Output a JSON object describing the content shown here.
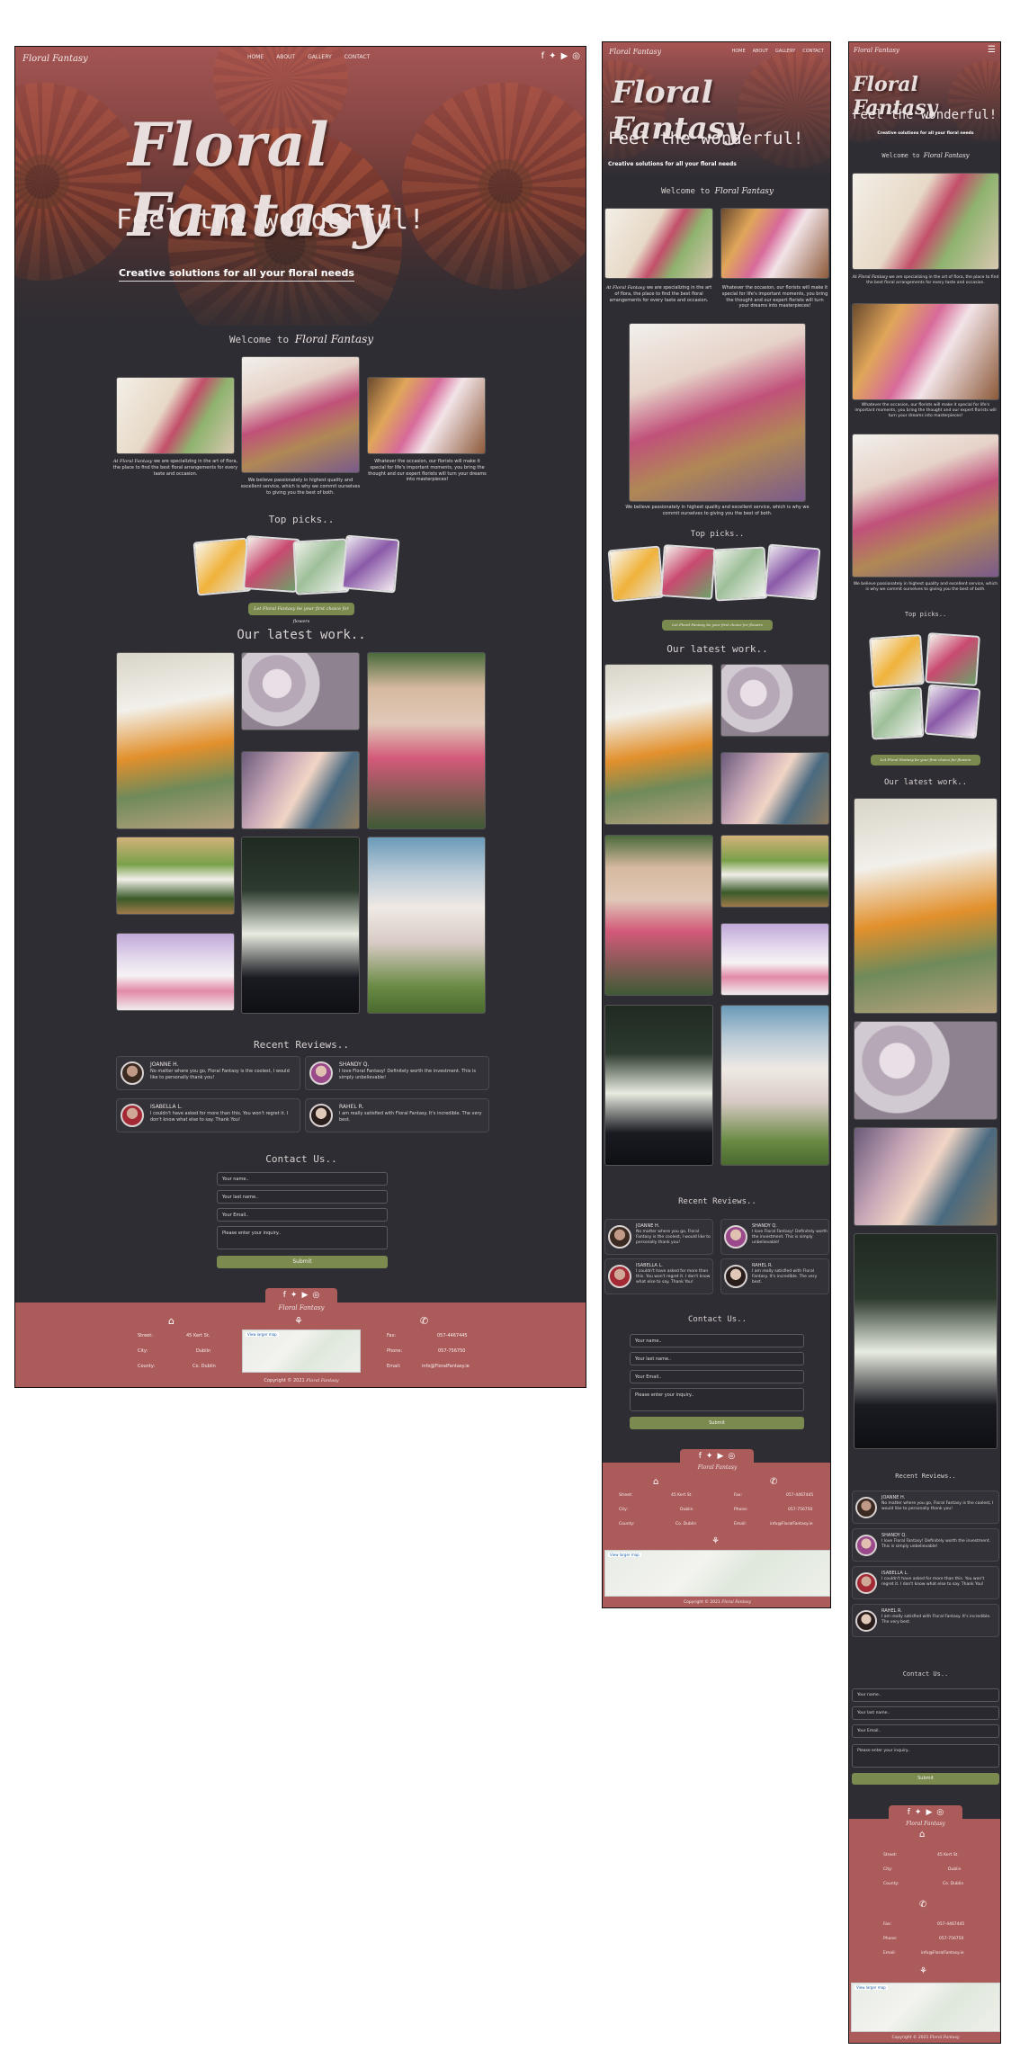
{
  "brand": "Floral Fantasy",
  "nav": {
    "home": "HOME",
    "about": "ABOUT",
    "gallery": "GALLERY",
    "contact": "CONTACT"
  },
  "hero": {
    "title": "Floral Fantasy",
    "subtitle": "Feel the wonderful!",
    "tagline": "Creative solutions for all your floral needs"
  },
  "welcome": {
    "prefix": "Welcome to ",
    "brand": "Floral Fantasy"
  },
  "about": {
    "p1_brand": "At Floral Fantasy",
    "p1": " we are specializing in the art of flora, the place to find the best floral arrangements for every taste and occasion.",
    "p2": "We believe passionately in highest quality and excellent service, which is why we commit ourselves to giving you the best of both.",
    "p3": "Whatever the occasion, our florists will make it special for life's important moments, you bring the thought and our expert florists will turn your dreams into masterpieces!"
  },
  "top_picks": {
    "title": "Top picks..",
    "button_prefix": "Let ",
    "button_brand": "Floral Fantasy",
    "button_suffix": " be your first choice for flowers"
  },
  "latest_work": {
    "title": "Our latest work.."
  },
  "reviews": {
    "title": "Recent Reviews..",
    "items": [
      {
        "name": "JOANNE H.",
        "text": "No matter where you go, Floral Fantasy is the coolest, I would like to personally thank you!"
      },
      {
        "name": "SHANDY Q.",
        "text": "I love Floral Fantasy! Definitely worth the investment. This is simply unbelievable!"
      },
      {
        "name": "ISABELLA L.",
        "text": "I couldn't have asked for more than this. You won't regret it. I don't know what else to say. Thank You!"
      },
      {
        "name": "RAHEL R.",
        "text": "I am really satisfied with Floral Fantasy. It's incredible. The very best."
      }
    ]
  },
  "contact": {
    "title": "Contact Us..",
    "name_ph": "Your name..",
    "last_ph": "Your last name..",
    "email_ph": "Your Email..",
    "inquiry_ph": "Please enter your inquiry..",
    "submit": "Submit"
  },
  "footer": {
    "street_label": "Street:",
    "street": "45 Kert St.",
    "city_label": "City:",
    "city": "Dublin",
    "county_label": "County:",
    "county": "Co. Dublin",
    "fax_label": "Fax:",
    "fax": "057-4467445",
    "phone_label": "Phone:",
    "phone": "057-756750",
    "email_label": "Email:",
    "email": "info@FloralFantasy.ie",
    "copyright_prefix": "Copyright © 2021 ",
    "copyright_brand": "Floral Fantasy",
    "map_label": "View larger map"
  },
  "colors": {
    "bg": "#2e2d33",
    "accent": "#ab5b5a",
    "button": "#7b8a4e"
  }
}
